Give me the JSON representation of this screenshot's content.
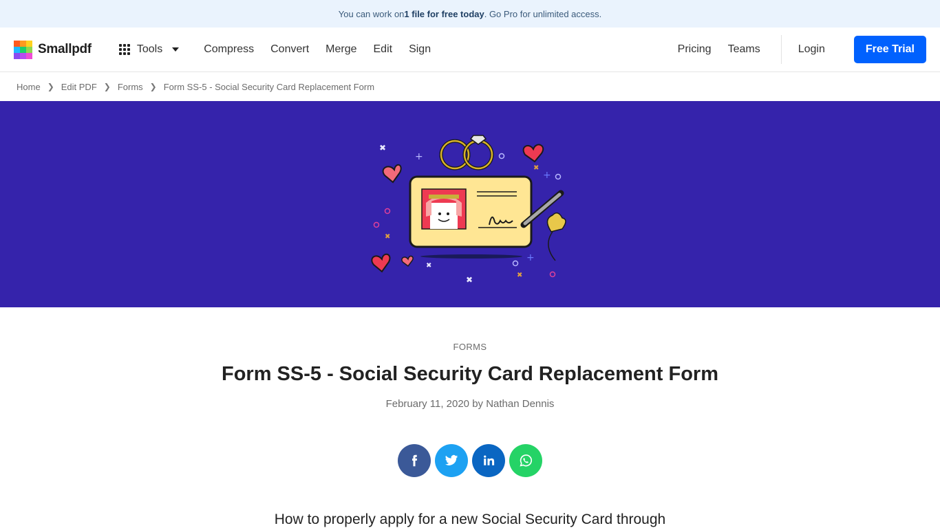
{
  "promo": {
    "prefix": "You can work on ",
    "bold": "1 file for free today",
    "suffix": ". Go Pro for unlimited access."
  },
  "nav": {
    "brand": "Smallpdf",
    "tools_label": "Tools",
    "links": [
      "Compress",
      "Convert",
      "Merge",
      "Edit",
      "Sign"
    ],
    "pricing": "Pricing",
    "teams": "Teams",
    "login": "Login",
    "free_trial": "Free Trial"
  },
  "breadcrumb": [
    "Home",
    "Edit PDF",
    "Forms",
    "Form SS-5 - Social Security Card Replacement Form"
  ],
  "hero": {
    "icon": "id-card-wedding-illustration"
  },
  "article": {
    "category": "FORMS",
    "title": "Form SS-5 - Social Security Card Replacement Form",
    "meta": "February 11, 2020 by Nathan Dennis",
    "intro": "How to properly apply for a new Social Security Card through"
  },
  "share": [
    {
      "name": "facebook",
      "icon": "facebook-icon",
      "color": "#3b5998"
    },
    {
      "name": "twitter",
      "icon": "twitter-icon",
      "color": "#1da1f2"
    },
    {
      "name": "linkedin",
      "icon": "linkedin-icon",
      "color": "#0a66c2"
    },
    {
      "name": "whatsapp",
      "icon": "whatsapp-icon",
      "color": "#25d366"
    }
  ],
  "colors": {
    "brand_blue": "#0061fe",
    "hero_bg": "#3523ab",
    "promo_bg": "#eaf3fd"
  }
}
